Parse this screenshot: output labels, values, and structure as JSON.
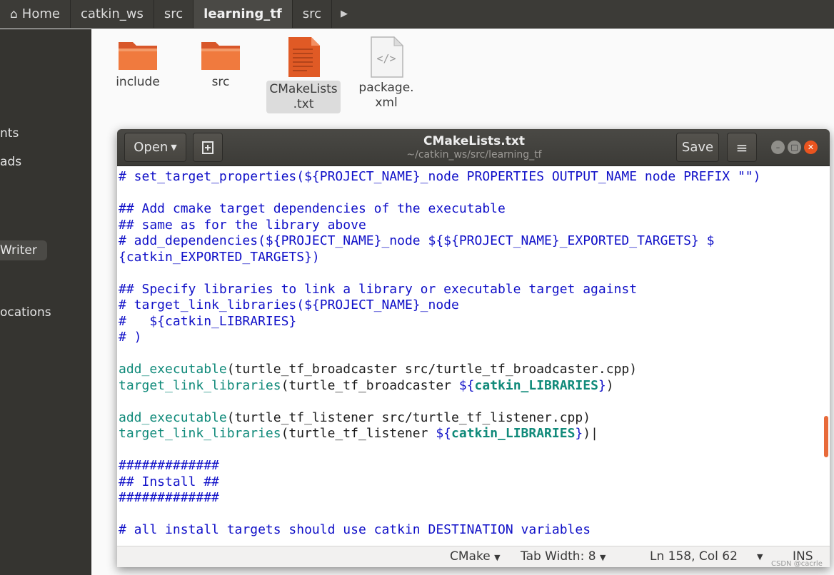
{
  "breadcrumbs": {
    "home": "Home",
    "items": [
      "catkin_ws",
      "src",
      "learning_tf",
      "src"
    ],
    "more_icon": "chevron-right-icon"
  },
  "sidebar": {
    "items": [
      "nts",
      "ads",
      "Writer",
      "ocations"
    ]
  },
  "files": [
    {
      "name": "include",
      "name2": "",
      "icon": "folder-icon"
    },
    {
      "name": "src",
      "name2": "",
      "icon": "folder-icon"
    },
    {
      "name": "CMakeLists",
      "name2": ".txt",
      "icon": "text-file-icon"
    },
    {
      "name": "package.",
      "name2": "xml",
      "icon": "xml-file-icon"
    }
  ],
  "editor_window": {
    "open_label": "Open",
    "save_label": "Save",
    "title": "CMakeLists.txt",
    "subtitle": "~/catkin_ws/src/learning_tf"
  },
  "code_lines": [
    {
      "parts": [
        {
          "c": "cm",
          "t": "# set_target_properties(${PROJECT_NAME}_node PROPERTIES OUTPUT_NAME node PREFIX \"\")"
        }
      ]
    },
    {
      "parts": []
    },
    {
      "parts": [
        {
          "c": "cm",
          "t": "## Add cmake target dependencies of the executable"
        }
      ]
    },
    {
      "parts": [
        {
          "c": "cm",
          "t": "## same as for the library above"
        }
      ]
    },
    {
      "parts": [
        {
          "c": "cm",
          "t": "# add_dependencies(${PROJECT_NAME}_node ${${PROJECT_NAME}_EXPORTED_TARGETS} $"
        }
      ]
    },
    {
      "parts": [
        {
          "c": "cm",
          "t": "{catkin_EXPORTED_TARGETS})"
        }
      ]
    },
    {
      "parts": []
    },
    {
      "parts": [
        {
          "c": "cm",
          "t": "## Specify libraries to link a library or executable target against"
        }
      ]
    },
    {
      "parts": [
        {
          "c": "cm",
          "t": "# target_link_libraries(${PROJECT_NAME}_node"
        }
      ]
    },
    {
      "parts": [
        {
          "c": "cm",
          "t": "#   ${catkin_LIBRARIES}"
        }
      ]
    },
    {
      "parts": [
        {
          "c": "cm",
          "t": "# )"
        }
      ]
    },
    {
      "parts": []
    },
    {
      "parts": [
        {
          "c": "fn",
          "t": "add_executable"
        },
        {
          "c": "",
          "t": "(turtle_tf_broadcaster src/turtle_tf_broadcaster.cpp)"
        }
      ]
    },
    {
      "parts": [
        {
          "c": "fn",
          "t": "target_link_libraries"
        },
        {
          "c": "",
          "t": "(turtle_tf_broadcaster "
        },
        {
          "c": "cm",
          "t": "${"
        },
        {
          "c": "kw",
          "t": "catkin_LIBRARIES"
        },
        {
          "c": "cm",
          "t": "}"
        },
        {
          "c": "",
          "t": ")"
        }
      ]
    },
    {
      "parts": []
    },
    {
      "parts": [
        {
          "c": "fn",
          "t": "add_executable"
        },
        {
          "c": "",
          "t": "(turtle_tf_listener src/turtle_tf_listener.cpp)"
        }
      ]
    },
    {
      "parts": [
        {
          "c": "fn",
          "t": "target_link_libraries"
        },
        {
          "c": "",
          "t": "(turtle_tf_listener "
        },
        {
          "c": "cm",
          "t": "${"
        },
        {
          "c": "kw",
          "t": "catkin_LIBRARIES"
        },
        {
          "c": "cm",
          "t": "}"
        },
        {
          "c": "",
          "t": ")|"
        }
      ]
    },
    {
      "parts": []
    },
    {
      "parts": [
        {
          "c": "cm",
          "t": "#############"
        }
      ]
    },
    {
      "parts": [
        {
          "c": "cm",
          "t": "## Install ##"
        }
      ]
    },
    {
      "parts": [
        {
          "c": "cm",
          "t": "#############"
        }
      ]
    },
    {
      "parts": []
    },
    {
      "parts": [
        {
          "c": "cm",
          "t": "# all install targets should use catkin DESTINATION variables"
        }
      ]
    }
  ],
  "statusbar": {
    "language": "CMake",
    "tab_width": "Tab Width: 8",
    "position": "Ln 158, Col 62",
    "mode": "INS"
  },
  "watermark": "CSDN @cacrle",
  "colors": {
    "accent": "#e95420",
    "comment": "#1010c8",
    "function": "#108a7a"
  }
}
